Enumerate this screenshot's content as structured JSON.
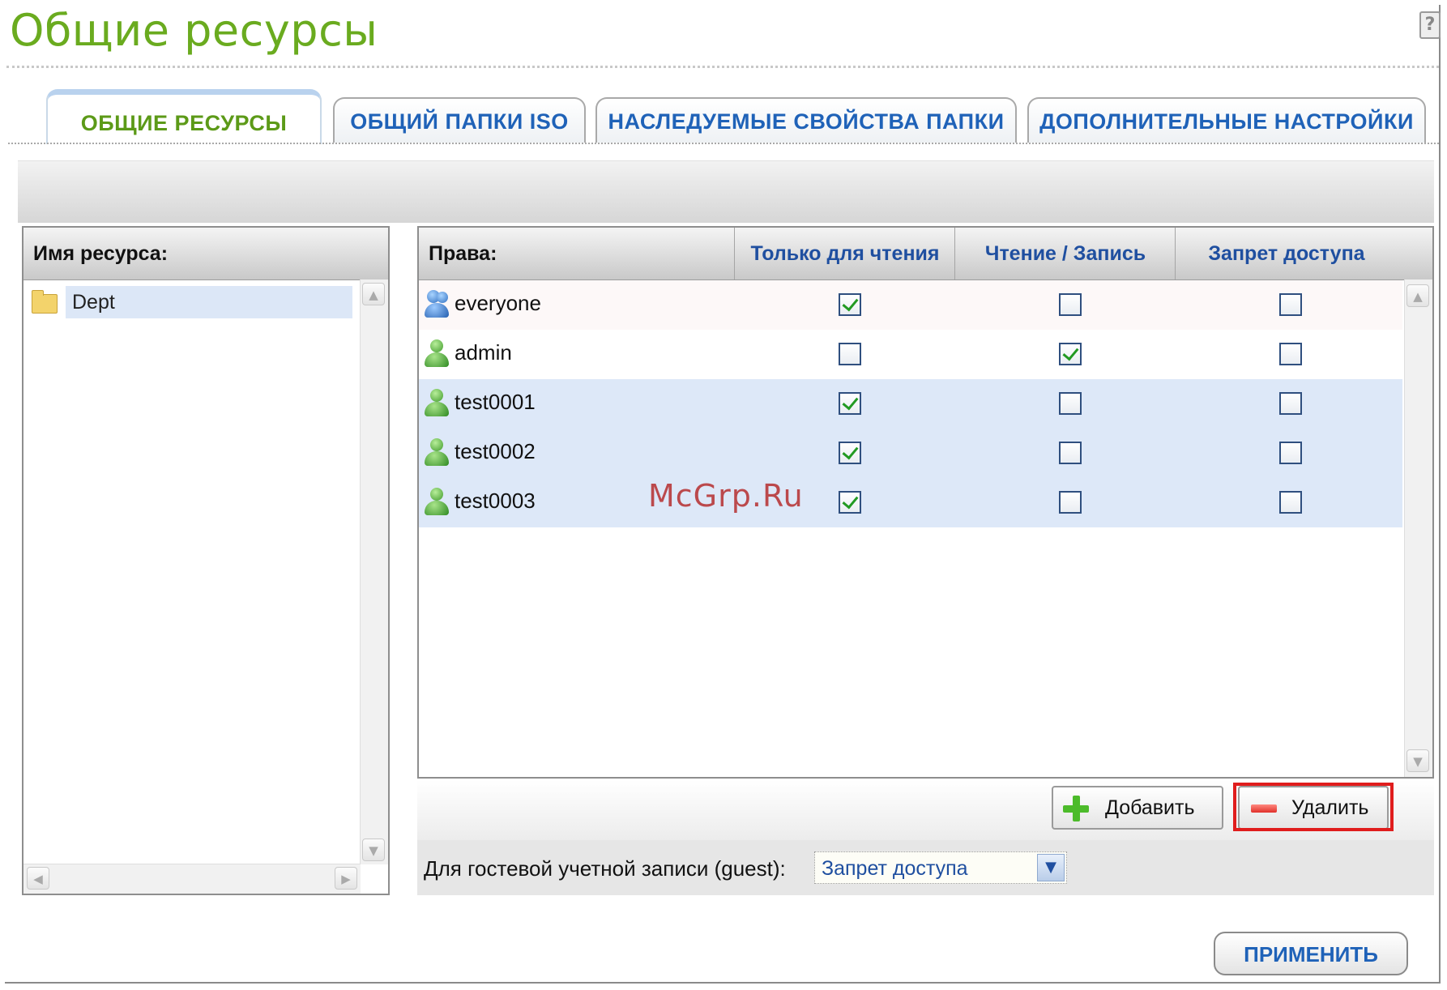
{
  "page": {
    "title": "Общие ресурсы",
    "help_glyph": "?"
  },
  "tabs": [
    {
      "label": "ОБЩИЕ РЕСУРСЫ",
      "active": true
    },
    {
      "label": "ОБЩИЙ ПАПКИ ISO",
      "active": false
    },
    {
      "label": "НАСЛЕДУЕМЫЕ СВОЙСТВА ПАПКИ",
      "active": false
    },
    {
      "label": "ДОПОЛНИТЕЛЬНЫЕ НАСТРОЙКИ",
      "active": false
    }
  ],
  "resources": {
    "header": "Имя ресурса:",
    "items": [
      {
        "name": "Dept",
        "icon": "folder-icon",
        "selected": true
      }
    ]
  },
  "permissions": {
    "columns": [
      "Права:",
      "Только для чтения",
      "Чтение / Запись",
      "Запрет доступа"
    ],
    "rows": [
      {
        "name": "everyone",
        "icon": "user-group-icon",
        "read_only": true,
        "read_write": false,
        "deny": false
      },
      {
        "name": "admin",
        "icon": "user-icon",
        "read_only": false,
        "read_write": true,
        "deny": false
      },
      {
        "name": "test0001",
        "icon": "user-icon",
        "read_only": true,
        "read_write": false,
        "deny": false
      },
      {
        "name": "test0002",
        "icon": "user-icon",
        "read_only": true,
        "read_write": false,
        "deny": false
      },
      {
        "name": "test0003",
        "icon": "user-icon",
        "read_only": true,
        "read_write": false,
        "deny": false
      }
    ]
  },
  "actions": {
    "add_label": "Добавить",
    "remove_label": "Удалить"
  },
  "guest": {
    "label": "Для гостевой учетной записи (guest):",
    "value": "Запрет доступа"
  },
  "apply_label": "ПРИМЕНИТЬ",
  "watermark": "McGrp.Ru",
  "colors": {
    "title_green": "#6aab1f",
    "tab_blue": "#1f62b8",
    "highlight_red": "#e01d1d"
  }
}
